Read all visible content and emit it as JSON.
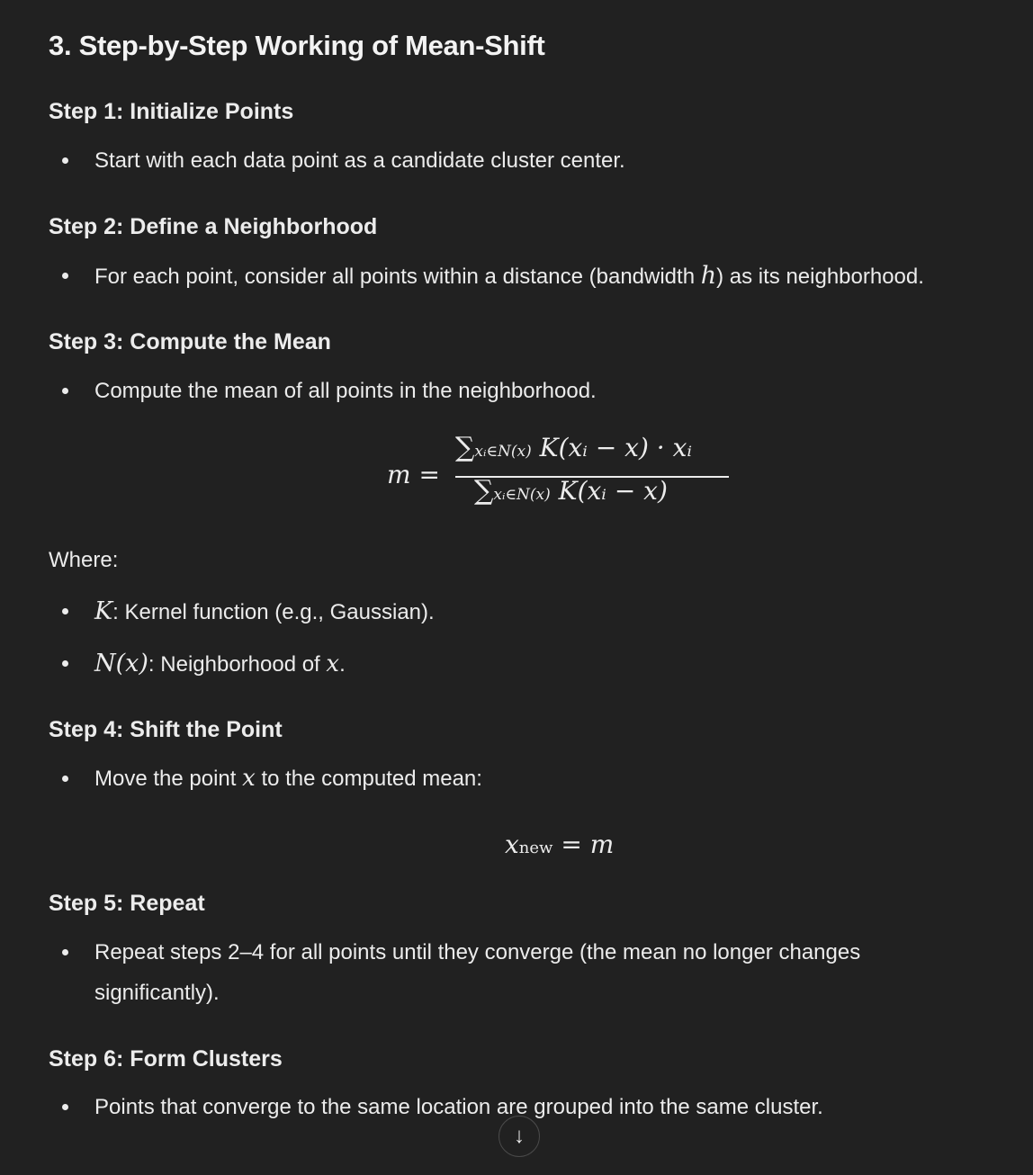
{
  "heading": "3. Step-by-Step Working of Mean-Shift",
  "step1": {
    "title": "Step 1: Initialize Points",
    "bullet": "Start with each data point as a candidate cluster center."
  },
  "step2": {
    "title": "Step 2: Define a Neighborhood",
    "bullet_pre": "For each point, consider all points within a distance (bandwidth ",
    "bullet_var": "h",
    "bullet_post": ") as its neighborhood."
  },
  "step3": {
    "title": "Step 3: Compute the Mean",
    "bullet": "Compute the mean of all points in the neighborhood.",
    "formula": {
      "lhs": "m =",
      "numerator": "K(xᵢ − x) · xᵢ",
      "denominator": "K(xᵢ − x)",
      "sum_symbol": "∑",
      "sum_index": "xᵢ∈N(x)"
    },
    "where_label": "Where:",
    "where_items": [
      {
        "symbol": "K",
        "text": ": Kernel function (e.g., Gaussian)."
      },
      {
        "symbol": "N(x)",
        "text": ": Neighborhood of ",
        "var": "x",
        "end": "."
      }
    ]
  },
  "step4": {
    "title": "Step 4: Shift the Point",
    "bullet_pre": "Move the point ",
    "bullet_var": "x",
    "bullet_post": " to the computed mean:",
    "formula": {
      "var": "x",
      "sub": "new",
      "rhs": " = m"
    }
  },
  "step5": {
    "title": "Step 5: Repeat",
    "bullet": "Repeat steps 2–4 for all points until they converge (the mean no longer changes significantly)."
  },
  "step6": {
    "title": "Step 6: Form Clusters",
    "bullet": "Points that converge to the same location are grouped into the same cluster."
  },
  "scroll_button": {
    "icon": "arrow-down-icon",
    "glyph": "↓"
  }
}
